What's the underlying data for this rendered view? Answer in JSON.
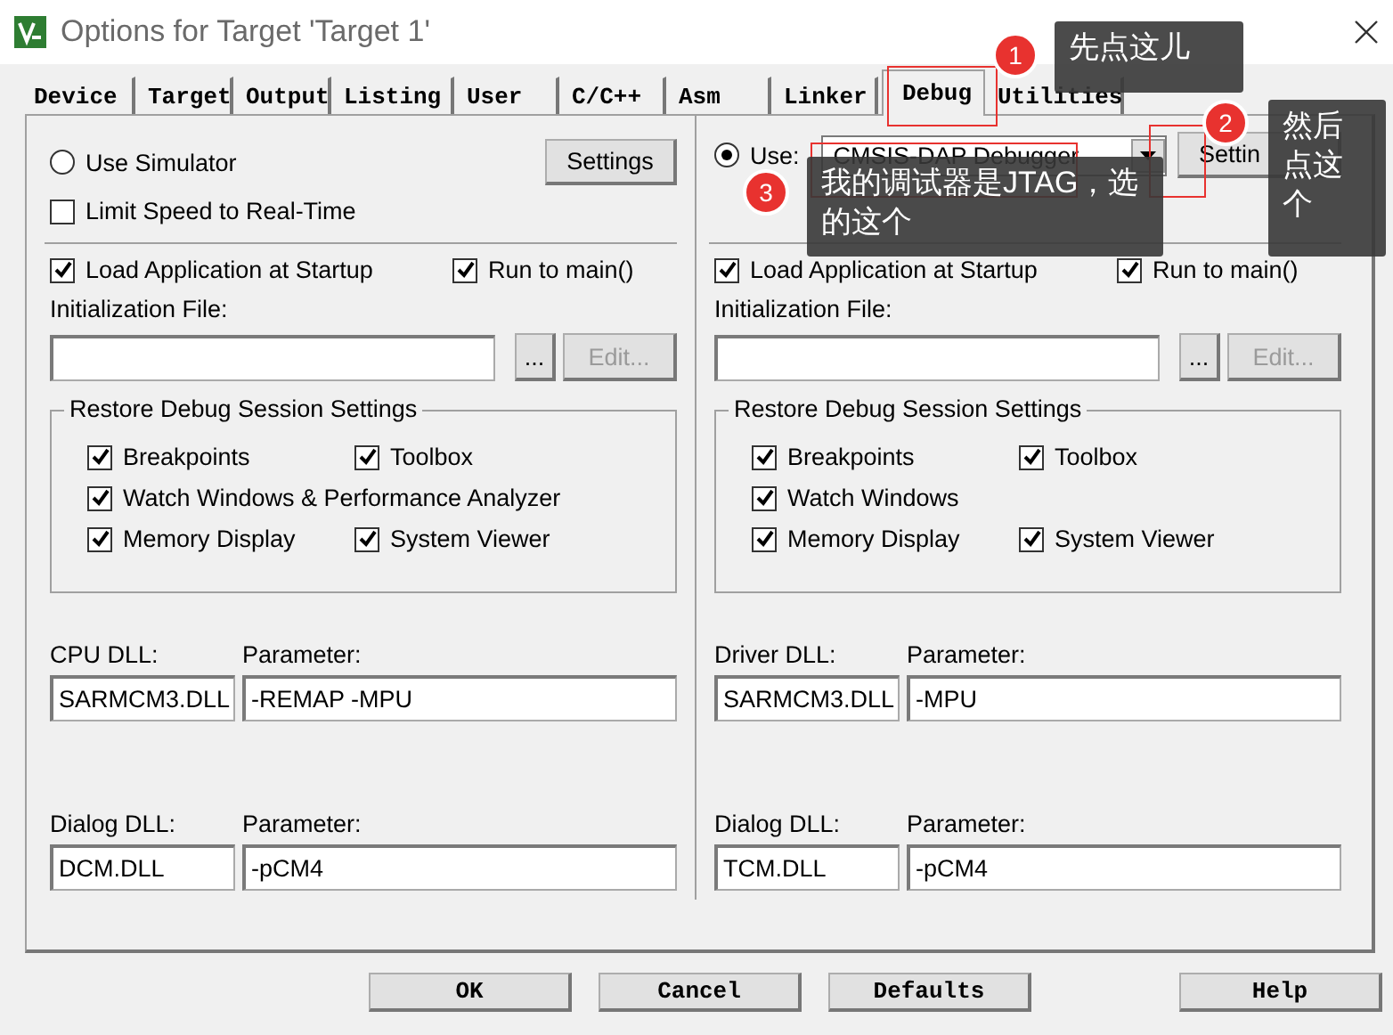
{
  "window": {
    "title": "Options for Target 'Target 1'"
  },
  "tabs": [
    {
      "label": "Device",
      "selected": false
    },
    {
      "label": "Target",
      "selected": false
    },
    {
      "label": "Output",
      "selected": false
    },
    {
      "label": "Listing",
      "selected": false
    },
    {
      "label": "User",
      "selected": false
    },
    {
      "label": "C/C++",
      "selected": false
    },
    {
      "label": "Asm",
      "selected": false
    },
    {
      "label": "Linker",
      "selected": false
    },
    {
      "label": "Debug",
      "selected": true
    },
    {
      "label": "Utilities",
      "selected": false
    }
  ],
  "simulator": {
    "radio": {
      "label": "Use Simulator",
      "selected": false
    },
    "settings_button": "Settings",
    "limit_speed": {
      "label": "Limit Speed to Real-Time",
      "checked": false
    }
  },
  "target": {
    "radio": {
      "label": "Use:",
      "selected": true
    },
    "driver": "CMSIS-DAP Debugger",
    "settings_button": "Settin"
  },
  "panels": [
    {
      "load_app": {
        "label": "Load Application at Startup",
        "checked": true
      },
      "run_to_main": {
        "label": "Run to main()",
        "checked": true
      },
      "init_file_label": "Initialization File:",
      "browse_button": "...",
      "edit_button": {
        "label": "Edit...",
        "disabled": true
      },
      "restore": {
        "title": "Restore Debug Session Settings",
        "options": [
          {
            "label": "Breakpoints",
            "checked": true,
            "full_row": false
          },
          {
            "label": "Toolbox",
            "checked": true,
            "full_row": false
          },
          {
            "label": "Watch Windows & Performance Analyzer",
            "checked": true,
            "full_row": true
          },
          {
            "label": "Memory Display",
            "checked": true,
            "full_row": false
          },
          {
            "label": "System Viewer",
            "checked": true,
            "full_row": false
          }
        ]
      },
      "dll_rows": [
        {
          "dll_label": "CPU DLL:",
          "dll_value": "SARMCM3.DLL",
          "param_label": "Parameter:",
          "param_value": "-REMAP -MPU"
        },
        {
          "dll_label": "Dialog DLL:",
          "dll_value": "DCM.DLL",
          "param_label": "Parameter:",
          "param_value": "-pCM4"
        }
      ]
    },
    {
      "load_app": {
        "label": "Load Application at Startup",
        "checked": true
      },
      "run_to_main": {
        "label": "Run to main()",
        "checked": true
      },
      "init_file_label": "Initialization File:",
      "browse_button": "...",
      "edit_button": {
        "label": "Edit...",
        "disabled": true
      },
      "restore": {
        "title": "Restore Debug Session Settings",
        "options": [
          {
            "label": "Breakpoints",
            "checked": true,
            "full_row": false
          },
          {
            "label": "Toolbox",
            "checked": true,
            "full_row": false
          },
          {
            "label": "Watch Windows",
            "checked": true,
            "full_row": true
          },
          {
            "label": "Memory Display",
            "checked": true,
            "full_row": false
          },
          {
            "label": "System Viewer",
            "checked": true,
            "full_row": false
          }
        ]
      },
      "dll_rows": [
        {
          "dll_label": "Driver DLL:",
          "dll_value": "SARMCM3.DLL",
          "param_label": "Parameter:",
          "param_value": "-MPU"
        },
        {
          "dll_label": "Dialog DLL:",
          "dll_value": "TCM.DLL",
          "param_label": "Parameter:",
          "param_value": "-pCM4"
        }
      ]
    }
  ],
  "buttons": [
    {
      "label": "OK"
    },
    {
      "label": "Cancel"
    },
    {
      "label": "Defaults"
    },
    {
      "label": "Help"
    }
  ],
  "callouts": [
    {
      "number": "1",
      "text": "先点这儿"
    },
    {
      "number": "2",
      "text": "然后点这个"
    },
    {
      "number": "3",
      "text": "我的调试器是JTAG，选的这个"
    }
  ]
}
